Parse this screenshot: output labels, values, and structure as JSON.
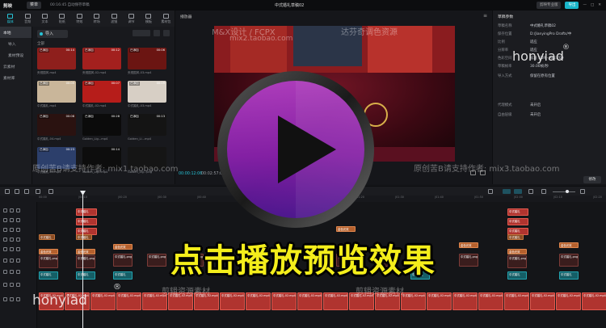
{
  "app": {
    "logo": "剪映",
    "menu_label": "菜单",
    "autosave": "00:16:45 自动保存草稿",
    "project_title": "中式婚礼草稿02",
    "feedback": "剪映专业版",
    "export": "导出"
  },
  "tool_tabs": [
    {
      "label": "媒体",
      "icon": "media-icon",
      "active": true
    },
    {
      "label": "音频",
      "icon": "audio-icon"
    },
    {
      "label": "文本",
      "icon": "text-icon"
    },
    {
      "label": "贴纸",
      "icon": "sticker-icon"
    },
    {
      "label": "特效",
      "icon": "effect-icon"
    },
    {
      "label": "转场",
      "icon": "transition-icon"
    },
    {
      "label": "滤镜",
      "icon": "filter-icon"
    },
    {
      "label": "调节",
      "icon": "adjust-icon"
    },
    {
      "label": "模板",
      "icon": "template-icon"
    },
    {
      "label": "素材包",
      "icon": "package-icon"
    }
  ],
  "sidenav": [
    {
      "label": "本地",
      "active": true
    },
    {
      "label": "导入",
      "sub": true
    },
    {
      "label": "素材预设",
      "sub": true
    },
    {
      "label": "云素材"
    },
    {
      "label": "素材库"
    }
  ],
  "media": {
    "import_label": "导入",
    "filter_all": "全部",
    "items": [
      {
        "name": "央视国风.mp4",
        "dur": "00:14",
        "added": "已添加",
        "color": "#8e1f1c"
      },
      {
        "name": "央视国风-02.mp4",
        "dur": "00:12",
        "added": "已添加",
        "color": "#a3201e"
      },
      {
        "name": "央视国风-03.mp4",
        "dur": "00:06",
        "added": "已添加",
        "color": "#6b1512"
      },
      {
        "name": "中式婚礼.mp4",
        "dur": "00:05",
        "added": "已添加",
        "color": "#c9b69a"
      },
      {
        "name": "中式婚礼-02.mp4",
        "dur": "00:07",
        "added": "已添加",
        "color": "#b61d1a"
      },
      {
        "name": "中式婚礼-03.mp4",
        "dur": "00:09",
        "added": "已添加",
        "color": "#d7cfc5"
      },
      {
        "name": "中式婚礼-04.mp4",
        "dur": "00:08",
        "added": "已添加",
        "color": "#2a1210"
      },
      {
        "name": "Golden_Lig...mp4",
        "dur": "00:28",
        "added": "已添加",
        "color": "#0b0b0b"
      },
      {
        "name": "Golden_Li...mp4",
        "dur": "00:13",
        "added": "已添加",
        "color": "#141414"
      },
      {
        "name": "中式婚礼-05.mp4",
        "dur": "00:23",
        "added": "已添加",
        "color": "#2c3f6b"
      },
      {
        "name": "Golden_Lig...mp4",
        "dur": "00:14",
        "added": "",
        "color": "#0d0d0d"
      },
      {
        "name": "Golden_Lig...png",
        "dur": "",
        "added": "",
        "color": "#151515"
      }
    ]
  },
  "player": {
    "label": "播放器",
    "time_current": "00:00:12:06",
    "time_total": "00:02:57:00"
  },
  "details": {
    "header": "草稿参数",
    "rows": [
      {
        "k": "草稿名称",
        "v": "中式婚礼草稿02"
      },
      {
        "k": "保存位置",
        "v": "D:/JianyingPro Drafts/中"
      },
      {
        "k": "比例",
        "v": "适应"
      },
      {
        "k": "分辨率",
        "v": "适应"
      },
      {
        "k": "色彩空间",
        "v": "标准 SDR - Rec.709"
      },
      {
        "k": "草稿帧率",
        "v": "30.00帧/秒"
      },
      {
        "k": "导入方式",
        "v": "保留在原有位置"
      },
      {
        "k": "代理模式",
        "v": "未开启"
      },
      {
        "k": "自由层级",
        "v": "未开启"
      }
    ],
    "modify": "修改"
  },
  "ruler_ticks": [
    "00:00",
    "|00:10",
    "|00:20",
    "|00:30",
    "|00:40",
    "|00:50",
    "|01:00",
    "|01:10",
    "|01:20",
    "|01:30",
    "|01:40",
    "|01:50",
    "|02:00",
    "|02:10",
    "|02:20"
  ],
  "clips": {
    "text_label": "中式婚礼",
    "sticker_label": "金色光效",
    "img_label": "中式婚礼.png",
    "main_label": "中式婚礼-02.mp4"
  },
  "watermarks": {
    "brand": "honyiad",
    "reg": "®",
    "top_center": "M&X设计 / FCPX",
    "top_center2": "mix2.taobao.com",
    "top_right": "达芬奇调色资源",
    "mid_left": "原创苦B请支持作者: mix1.taobao.com",
    "mid_right": "原创苦B请支持作者: mix3.taobao.com",
    "bottom_center": "剪辑资源素材",
    "bottom_center2": "剪辑资源素材"
  },
  "promo": "点击播放预览效果",
  "colors": {
    "accent": "#19b5c9",
    "promo": "#f4ee1b"
  }
}
